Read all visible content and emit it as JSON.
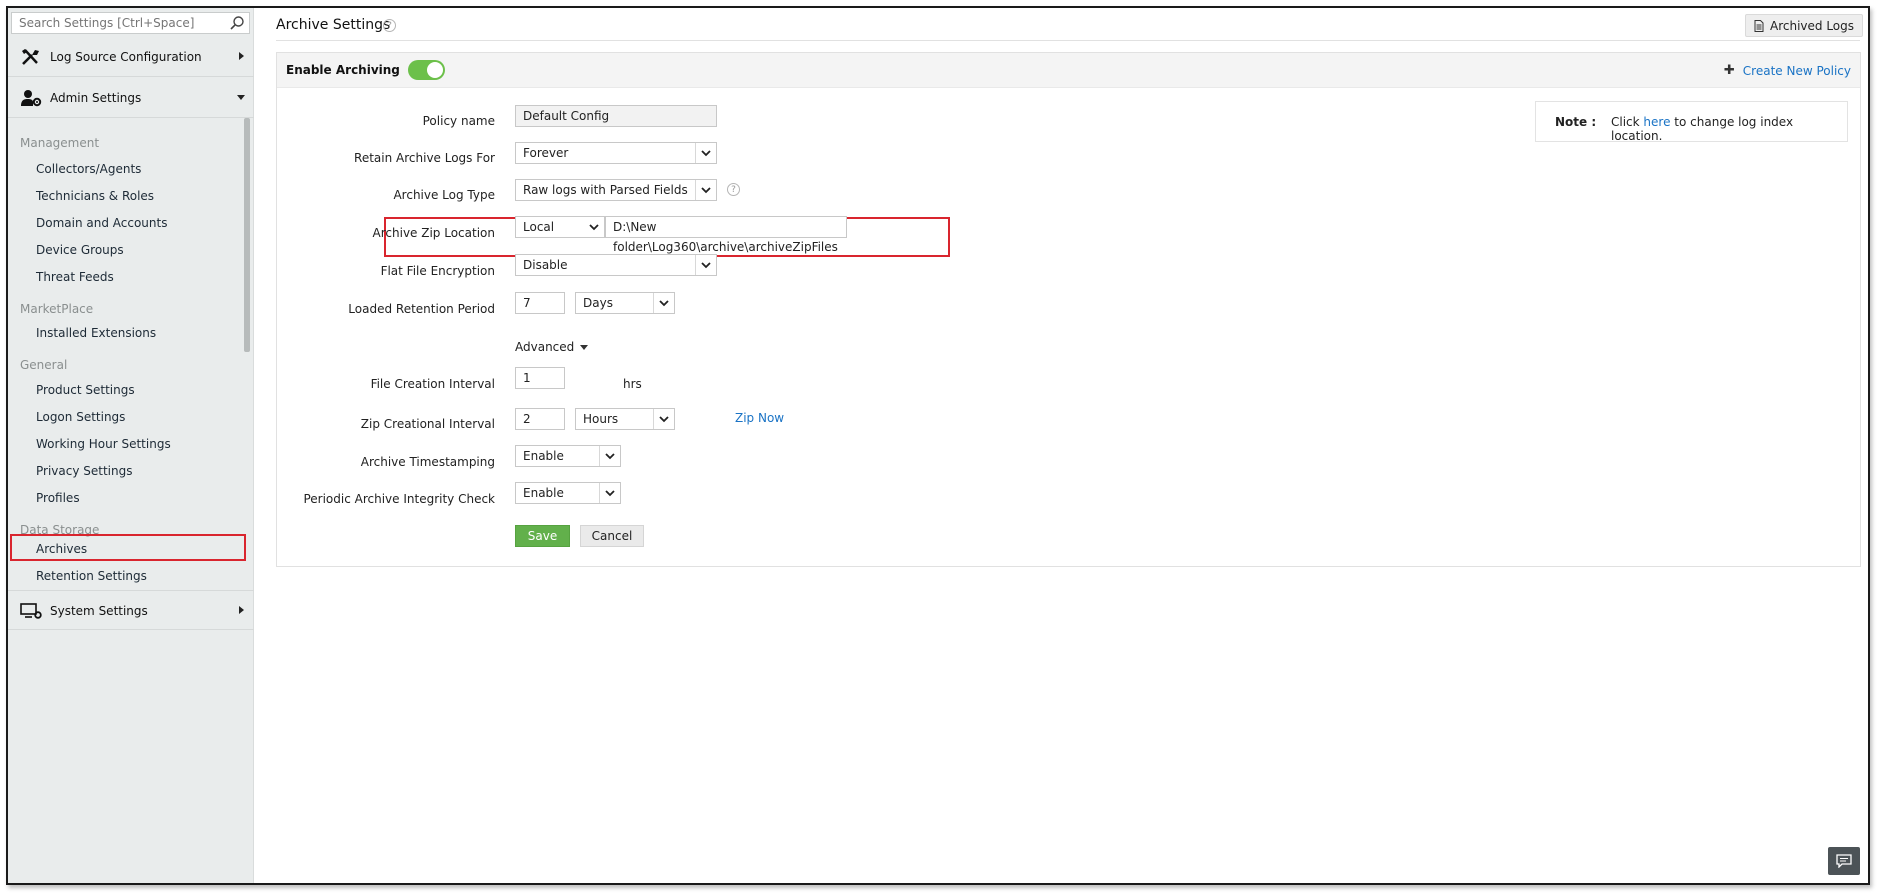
{
  "sidebar": {
    "search_placeholder": "Search Settings [Ctrl+Space]",
    "sections": {
      "log_source": "Log Source Configuration",
      "admin": "Admin Settings",
      "system": "System Settings"
    },
    "groups": {
      "management": "Management",
      "marketplace": "MarketPlace",
      "general": "General",
      "data_storage": "Data Storage"
    },
    "items": {
      "collectors": "Collectors/Agents",
      "technicians": "Technicians & Roles",
      "domain": "Domain and Accounts",
      "device_groups": "Device Groups",
      "threat_feeds": "Threat Feeds",
      "installed_ext": "Installed Extensions",
      "product_settings": "Product Settings",
      "logon_settings": "Logon Settings",
      "working_hour": "Working Hour Settings",
      "privacy": "Privacy Settings",
      "profiles": "Profiles",
      "archives": "Archives",
      "retention": "Retention Settings"
    }
  },
  "header": {
    "title": "Archive Settings",
    "help_glyph": "?",
    "archived_logs_button": "Archived Logs"
  },
  "card": {
    "enable_archiving_label": "Enable Archiving",
    "enable_archiving_on": true,
    "create_new_policy": "Create New Policy",
    "note": {
      "label": "Note :",
      "prefix": "Click",
      "link": "here",
      "suffix": "to change log index location."
    }
  },
  "form": {
    "policy_name": {
      "label": "Policy name",
      "value": "Default Config"
    },
    "retain_for": {
      "label": "Retain Archive Logs For",
      "value": "Forever"
    },
    "log_type": {
      "label": "Archive Log Type",
      "value": "Raw logs with Parsed Fields"
    },
    "zip_location": {
      "label": "Archive Zip Location",
      "location_type": "Local",
      "path": "D:\\New folder\\Log360\\archive\\archiveZipFiles"
    },
    "encryption": {
      "label": "Flat File Encryption",
      "value": "Disable"
    },
    "loaded_retention": {
      "label": "Loaded Retention Period",
      "value": "7",
      "unit": "Days"
    },
    "advanced_label": "Advanced",
    "file_creation": {
      "label": "File Creation Interval",
      "value": "1",
      "unit": "hrs"
    },
    "zip_interval": {
      "label": "Zip Creational Interval",
      "value": "2",
      "unit": "Hours",
      "zip_now": "Zip Now"
    },
    "timestamping": {
      "label": "Archive Timestamping",
      "value": "Enable"
    },
    "integrity_check": {
      "label": "Periodic Archive Integrity Check",
      "value": "Enable"
    },
    "save": "Save",
    "cancel": "Cancel"
  },
  "colors": {
    "accent_green": "#62b04b",
    "link_blue": "#1a73c5",
    "highlight_red": "#d9252e",
    "sidebar_bg": "#e9ecec"
  }
}
